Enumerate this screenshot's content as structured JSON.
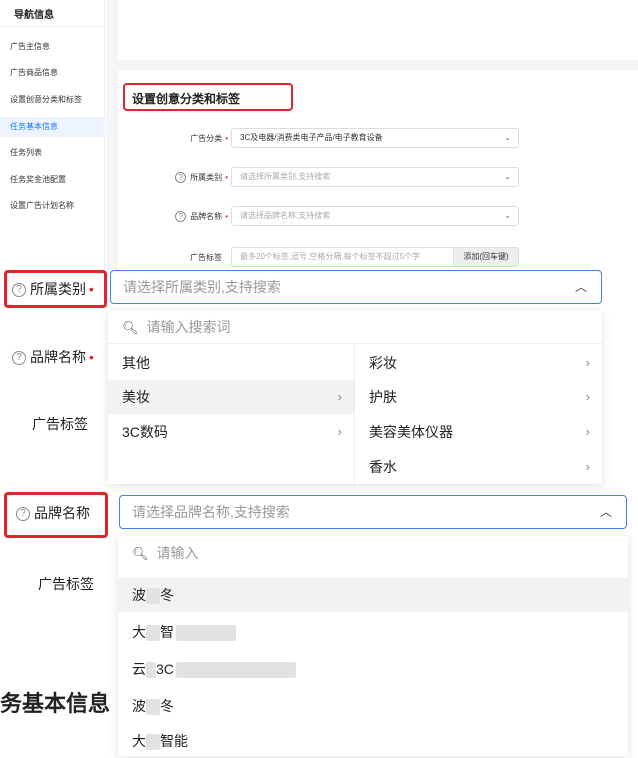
{
  "nav": {
    "title": "导航信息",
    "items": [
      "广告主信息",
      "广告商品信息",
      "设置创意分类和标签",
      "任务基本信息",
      "任务列表",
      "任务奖金池配置",
      "设置广告计划名称"
    ]
  },
  "section": {
    "title": "设置创意分类和标签"
  },
  "form": {
    "ad_category_label": "广告分类",
    "ad_category_value": "3C及电器/消费类电子产品/电子教育设备",
    "belong_category_label": "所属类别",
    "belong_category_placeholder": "请选择所属类别,支持搜索",
    "brand_label": "品牌名称",
    "brand_placeholder": "请选择品牌名称,支持搜索",
    "tag_label": "广告标签",
    "tag_placeholder": "最多20个标签,逗号,空格分隔,每个标签不超过5个字",
    "tag_button": "添加(回车键)"
  },
  "panel1": {
    "label": "所属类别",
    "placeholder": "请选择所属类别,支持搜索",
    "search_placeholder": "请输入搜索词",
    "left_items": [
      "其他",
      "美妆",
      "3C数码"
    ],
    "right_items": [
      "彩妆",
      "护肤",
      "美容美体仪器",
      "香水"
    ]
  },
  "panel1_side": {
    "brand_label": "品牌名称",
    "tag_label": "广告标签"
  },
  "panel2": {
    "label": "品牌名称",
    "placeholder": "请选择品牌名称,支持搜索",
    "search_placeholder": "请输入",
    "tag_label": "广告标签",
    "brands": [
      "波",
      "冬",
      "大",
      "智",
      "云",
      "3C",
      "波",
      "冬",
      "大",
      "智能"
    ]
  },
  "bottom": {
    "title": "务基本信息"
  },
  "colors": {
    "accent": "#3b82f6",
    "required": "#e0252c",
    "highlight_box": "#e0252c"
  }
}
